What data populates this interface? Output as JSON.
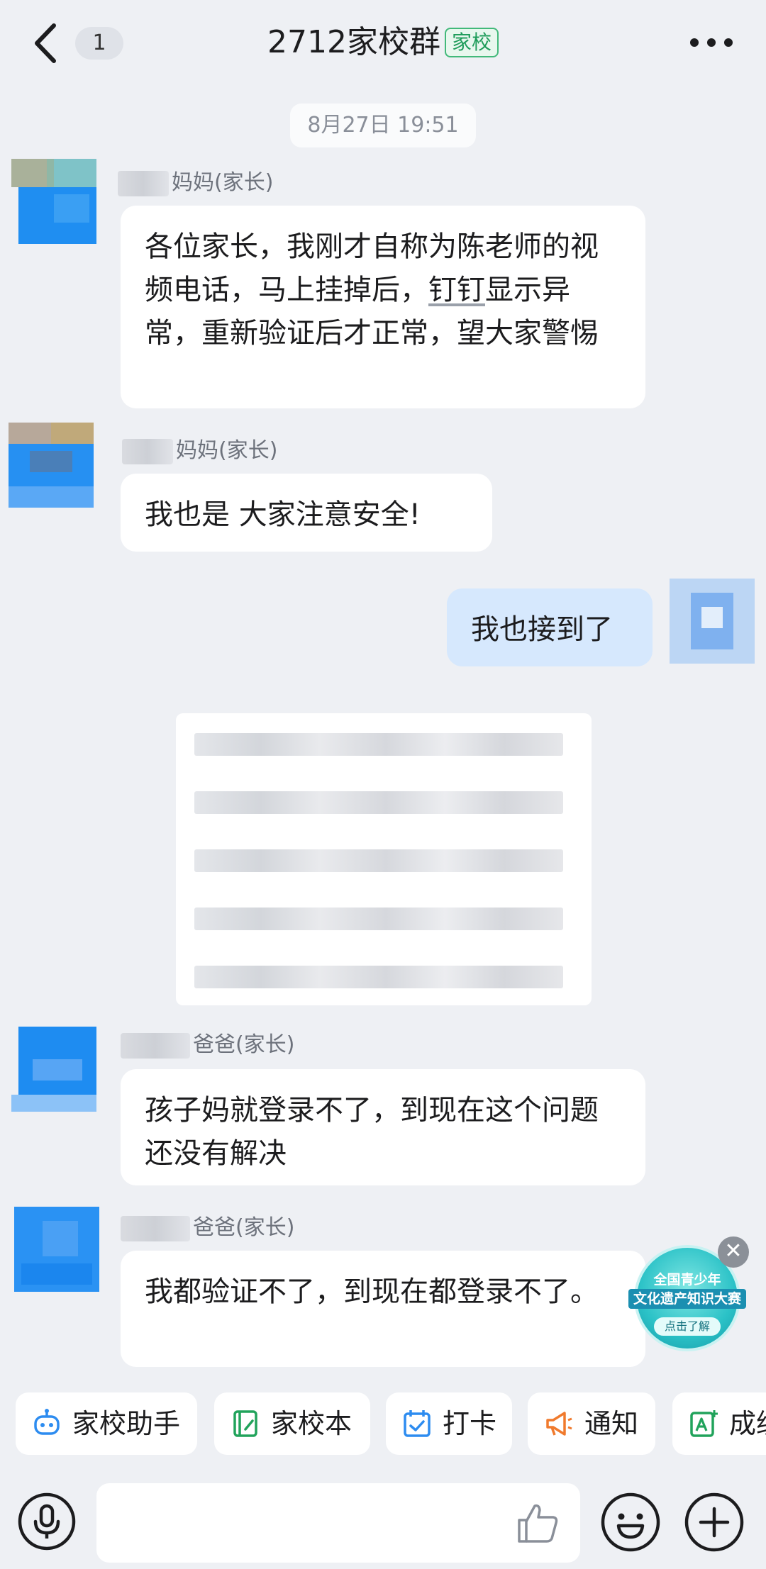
{
  "header": {
    "back_icon": "chevron-left-icon",
    "unread_count": "1",
    "title": "2712家校群",
    "title_tag": "家校",
    "more_icon": "more-dots-icon"
  },
  "chat": {
    "time_divider": "8月27日 19:51",
    "messages": [
      {
        "sender_suffix": "妈妈(家长)",
        "text_parts": [
          "各位家长，我刚才自称为陈老师的视频电话，马上挂掉后，",
          "钉钉",
          "显示异常，重新验证后才正常，望大家警惕"
        ]
      },
      {
        "sender_suffix": "妈妈(家长)",
        "text": "我也是 大家注意安全!"
      },
      {
        "self": true,
        "text": "我也接到了"
      },
      {
        "sender_suffix": "爸爸(家长)",
        "text": "孩子妈就登录不了，到现在这个问题还没有解决"
      },
      {
        "sender_suffix": "爸爸(家长)",
        "text": "我都验证不了，到现在都登录不了。"
      }
    ]
  },
  "promo": {
    "line1": "全国青少年",
    "line2": "文化遗产知识大赛",
    "cta": "点击了解",
    "close_icon": "close-icon"
  },
  "toolbar": {
    "items": [
      {
        "label": "家校助手",
        "icon": "robot-assistant-icon",
        "color": "#2d8cf0"
      },
      {
        "label": "家校本",
        "icon": "notebook-icon",
        "color": "#21a35b"
      },
      {
        "label": "打卡",
        "icon": "calendar-check-icon",
        "color": "#2d8cf0"
      },
      {
        "label": "通知",
        "icon": "megaphone-icon",
        "color": "#f07a2d"
      },
      {
        "label": "成绩",
        "icon": "grade-icon",
        "color": "#21a35b"
      }
    ]
  },
  "input_bar": {
    "placeholder": "",
    "mic_icon": "microphone-icon",
    "like_icon": "thumbs-up-icon",
    "emoji_icon": "emoji-icon",
    "plus_icon": "plus-circle-icon"
  }
}
